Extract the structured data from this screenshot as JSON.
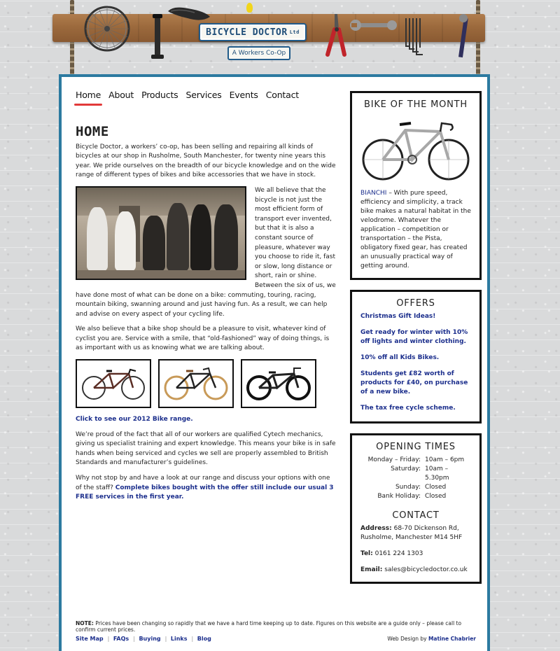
{
  "header": {
    "logo_main": "BICYCLE DOCTOR",
    "logo_ltd": "Ltd",
    "logo_sub": "A Workers Co-Op"
  },
  "nav": [
    {
      "label": "Home",
      "active": true
    },
    {
      "label": "About"
    },
    {
      "label": "Products"
    },
    {
      "label": "Services"
    },
    {
      "label": "Events"
    },
    {
      "label": "Contact"
    }
  ],
  "main": {
    "title": "HOME",
    "intro": "Bicycle Doctor, a workers’ co-op, has been selling and repairing all kinds of bicycles at our shop in Rusholme, South Manchester, for twenty nine years this year. We pride ourselves on the breadth of our bicycle knowledge and on the wide range of different types of bikes and bike accessories that we have in stock.",
    "para2": "We all believe that the bicycle is not just the most efficient form of transport ever invented, but that it is also a constant source of pleasure, whatever way you choose to ride it, fast or slow, long distance or short, rain or shine. Between the six of us, we have done most of what can be done on a bike: commuting, touring, racing, mountain biking, swanning around and just having fun. As a result, we can help and advise on every aspect of your cycling life.",
    "para3": "We also believe that a bike shop should be a pleasure to visit, whatever kind of cyclist you are. Service with a smile, that “old-fashioned” way of doing things, is as important with us as knowing what we are talking about.",
    "bike_range_link": "Click to see our 2012 Bike range.",
    "para4": "We’re proud of the fact that all of our workers are qualified Cytech mechanics, giving us specialist training and expert knowledge. This means your bike is in safe hands when being serviced and cycles we sell are properly assembled to British Standards and manufacturer’s guidelines.",
    "para5_text": "Why not stop by and have a look at our range and discuss your options with one of the staff?",
    "para5_link": "Complete bikes bought with the offer still include our usual 3 FREE services in the first year."
  },
  "sidebar": {
    "bike_of_month": {
      "title": "BIKE OF THE MONTH",
      "brand": "BIANCHI",
      "desc": "– With pure speed, efficiency and simplicity, a track bike makes a natural habitat in the velodrome. Whatever the application – competition or transportation – the Pista, obligatory fixed gear, has created an unusually practical way of getting around."
    },
    "offers": {
      "title": "OFFERS",
      "items": [
        "Christmas Gift Ideas!",
        "Get ready for winter with 10% off lights and winter clothing.",
        "10% off all Kids Bikes.",
        "Students get £82 worth of products for £40, on purchase of a new bike.",
        "The tax free cycle scheme."
      ]
    },
    "hours": {
      "title": "OPENING TIMES",
      "rows": [
        {
          "day": "Monday – Friday:",
          "time": "10am – 6pm"
        },
        {
          "day": "Saturday:",
          "time": "10am – 5.30pm"
        },
        {
          "day": "Sunday:",
          "time": "Closed"
        },
        {
          "day": "Bank Holiday:",
          "time": "Closed"
        }
      ]
    },
    "contact": {
      "title": "CONTACT",
      "address_label": "Address:",
      "address": "68-70 Dickenson Rd, Rusholme, Manchester M14 5HF",
      "tel_label": "Tel:",
      "tel": "0161 224 1303",
      "email_label": "Email:",
      "email": "sales@bicycledoctor.co.uk"
    }
  },
  "footer": {
    "note_label": "NOTE:",
    "note": "Prices have been changing so rapidly that we have a hard time keeping up to date. Figures on this website are a guide only – please call to confirm current prices.",
    "links": [
      "Site Map",
      "FAQs",
      "Buying",
      "Links",
      "Blog"
    ],
    "credit_text": "Web Design by",
    "credit_name": "Matine Chabrier"
  },
  "colors": {
    "border_blue": "#2c7aa0",
    "link_blue": "#1b2e8c",
    "active_underline": "#e23a3a"
  }
}
